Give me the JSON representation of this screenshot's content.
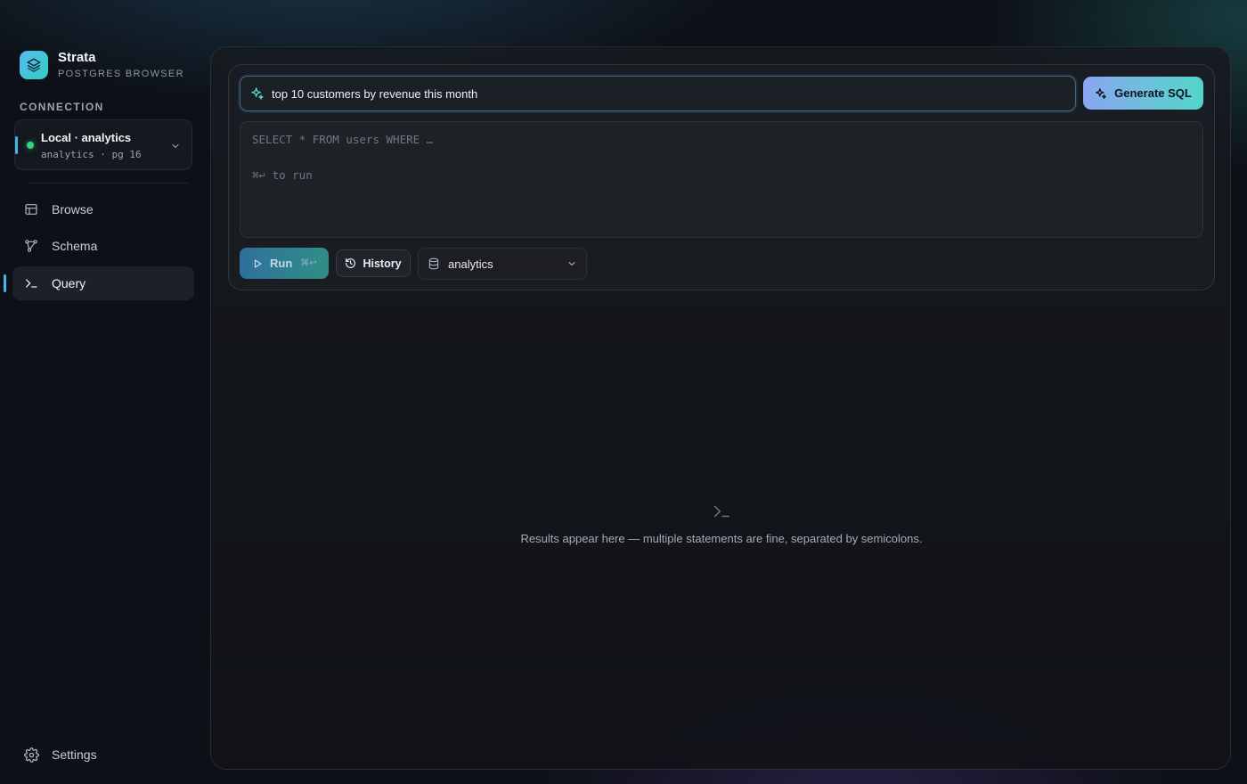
{
  "brand": {
    "name": "Strata",
    "subtitle": "POSTGRES BROWSER"
  },
  "connection": {
    "section_label": "CONNECTION",
    "name": "Local · analytics",
    "detail": "analytics · pg 16",
    "status_color": "#37d47d"
  },
  "nav": {
    "items": [
      {
        "label": "Browse",
        "icon": "table-icon"
      },
      {
        "label": "Schema",
        "icon": "schema-icon"
      },
      {
        "label": "Query",
        "icon": "terminal-icon",
        "active": true
      }
    ],
    "settings_label": "Settings"
  },
  "query": {
    "prompt_value": "top 10 customers by revenue this month",
    "generate_label": "Generate SQL",
    "editor_placeholder": "SELECT * FROM users WHERE …",
    "editor_hint": "⌘↩ to run",
    "run_label": "Run",
    "run_shortcut": "⌘↩",
    "history_label": "History",
    "database_selected": "analytics"
  },
  "results": {
    "empty_message": "Results appear here — multiple statements are fine, separated by semicolons."
  },
  "colors": {
    "accent": "#3fb7e8",
    "generate_gradient_start": "#8aa6f2",
    "generate_gradient_end": "#52d6c8",
    "run_gradient_start": "#2f6f9c",
    "run_gradient_end": "#2f8f86"
  }
}
